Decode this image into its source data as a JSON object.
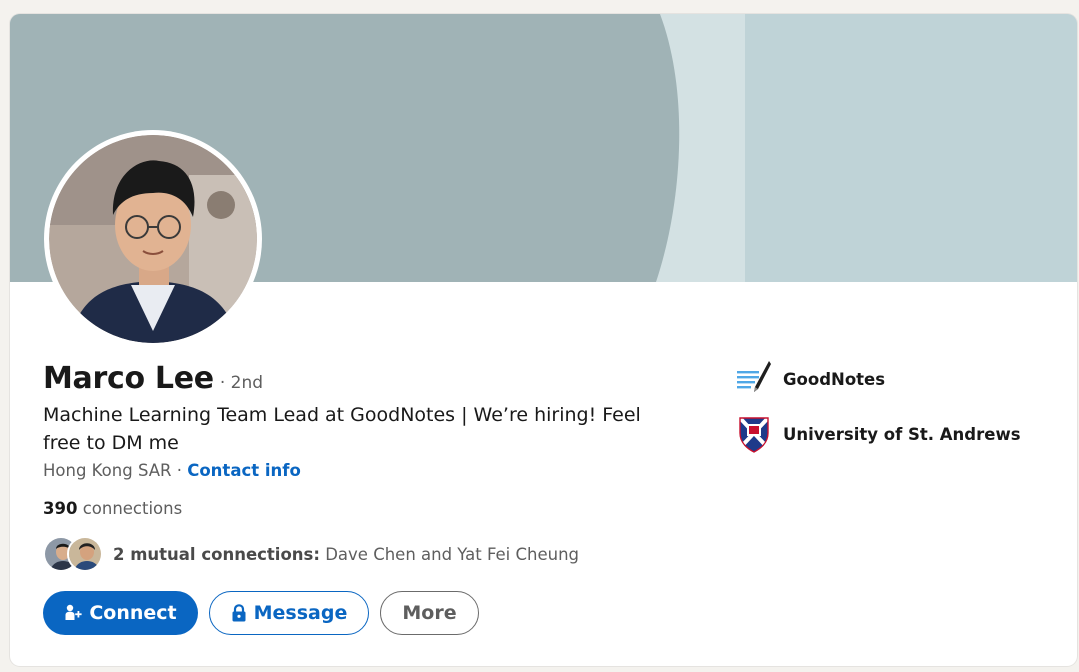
{
  "profile": {
    "name": "Marco Lee",
    "degree": "· 2nd",
    "headline": "Machine Learning Team Lead at GoodNotes | We’re hiring! Feel free to DM me",
    "location": "Hong Kong SAR",
    "location_separator": " · ",
    "contact_info": "Contact info",
    "connections_count": "390",
    "connections_label": " connections",
    "mutual_count_label": "2 mutual connections:",
    "mutual_names": " Dave Chen and Yat Fei Cheung"
  },
  "actions": {
    "connect_label": "Connect",
    "message_label": "Message",
    "more_label": "More"
  },
  "organizations": [
    {
      "name": "GoodNotes",
      "icon": "goodnotes-logo"
    },
    {
      "name": "University of St. Andrews",
      "icon": "st-andrews-crest"
    }
  ],
  "colors": {
    "accent": "#0a66c2",
    "banner_light": "#bfd3d7",
    "banner_dark": "#a0b3b6",
    "page_bg": "#f4f2ee"
  }
}
